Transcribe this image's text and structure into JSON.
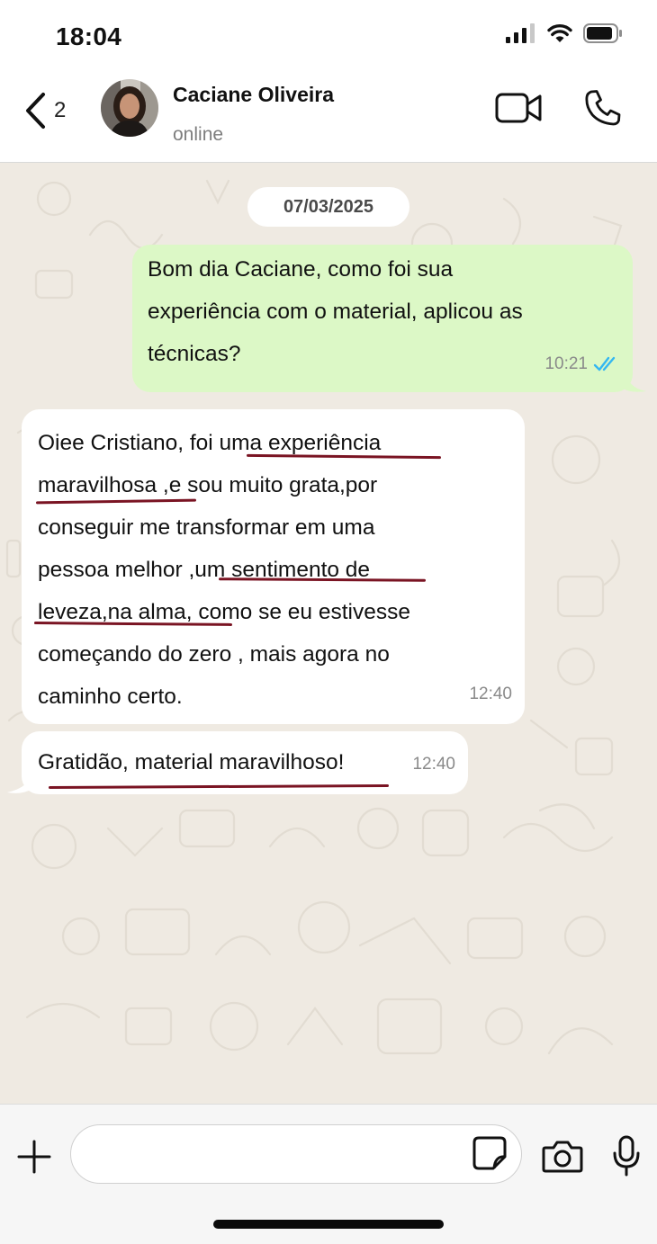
{
  "status_bar": {
    "time": "18:04"
  },
  "header": {
    "back_count": "2",
    "contact_name": "Caciane Oliveira",
    "contact_status": "online",
    "icons": [
      "chevron-left-icon",
      "video-call-icon",
      "phone-icon"
    ]
  },
  "chat": {
    "date": "07/03/2025",
    "messages": [
      {
        "direction": "outgoing",
        "lines": [
          "Bom dia Caciane, como foi sua",
          "experiência com o material, aplicou as",
          "técnicas?"
        ],
        "time": "10:21",
        "read": true
      },
      {
        "direction": "incoming",
        "lines": [
          "Oiee Cristiano, foi uma experiência",
          "maravilhosa ,e sou muito grata,por",
          "conseguir me transformar em uma",
          "pessoa melhor ,um sentimento de",
          "leveza,na alma, como se eu estivesse",
          "começando do zero , mais agora no",
          "caminho certo."
        ],
        "time": "12:40"
      },
      {
        "direction": "incoming",
        "lines": [
          "Gratidão, material maravilhoso!"
        ],
        "time": "12:40"
      }
    ]
  },
  "composer": {
    "placeholder": "",
    "icons": [
      "plus-icon",
      "sticker-icon",
      "camera-icon",
      "microphone-icon"
    ]
  },
  "colors": {
    "outgoing_bubble": "#dcf8c6",
    "incoming_bubble": "#ffffff",
    "chat_background": "#efeae2",
    "read_ticks": "#34b7f1",
    "highlight_underline": "#7a1423"
  }
}
